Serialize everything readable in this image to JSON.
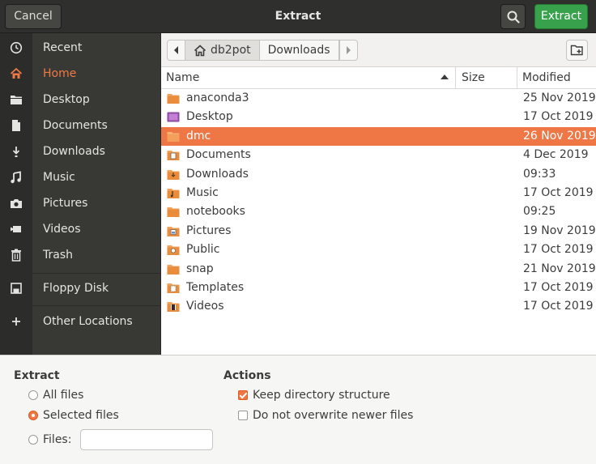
{
  "header": {
    "title": "Extract",
    "cancel_label": "Cancel",
    "extract_label": "Extract",
    "search_icon": "search-icon"
  },
  "sidebar": {
    "items": [
      {
        "label": "Recent",
        "icon": "clock-icon"
      },
      {
        "label": "Home",
        "icon": "home-icon",
        "active": true
      },
      {
        "label": "Desktop",
        "icon": "folder-icon"
      },
      {
        "label": "Documents",
        "icon": "document-icon"
      },
      {
        "label": "Downloads",
        "icon": "download-icon"
      },
      {
        "label": "Music",
        "icon": "music-icon"
      },
      {
        "label": "Pictures",
        "icon": "camera-icon"
      },
      {
        "label": "Videos",
        "icon": "video-icon"
      },
      {
        "label": "Trash",
        "icon": "trash-icon"
      },
      {
        "label": "Floppy Disk",
        "icon": "floppy-disk-icon"
      },
      {
        "label": "Other Locations",
        "icon": "plus-icon"
      }
    ]
  },
  "pathbar": {
    "segments": [
      "db2pot",
      "Downloads"
    ],
    "new_folder_icon": "new-folder-icon"
  },
  "filelist": {
    "columns": {
      "name": "Name",
      "size": "Size",
      "modified": "Modified"
    },
    "sort": "ascending",
    "rows": [
      {
        "name": "anaconda3",
        "modified": "25 Nov 2019",
        "icon": "folder"
      },
      {
        "name": "Desktop",
        "modified": "17 Oct 2019",
        "icon": "desktop-folder"
      },
      {
        "name": "dmc",
        "modified": "26 Nov 2019",
        "icon": "folder",
        "selected": true
      },
      {
        "name": "Documents",
        "modified": "4 Dec 2019",
        "icon": "documents-folder"
      },
      {
        "name": "Downloads",
        "modified": "09:33",
        "icon": "downloads-folder"
      },
      {
        "name": "Music",
        "modified": "17 Oct 2019",
        "icon": "music-folder"
      },
      {
        "name": "notebooks",
        "modified": "09:25",
        "icon": "folder"
      },
      {
        "name": "Pictures",
        "modified": "19 Nov 2019",
        "icon": "pictures-folder"
      },
      {
        "name": "Public",
        "modified": "17 Oct 2019",
        "icon": "public-folder"
      },
      {
        "name": "snap",
        "modified": "21 Nov 2019",
        "icon": "folder"
      },
      {
        "name": "Templates",
        "modified": "17 Oct 2019",
        "icon": "templates-folder"
      },
      {
        "name": "Videos",
        "modified": "17 Oct 2019",
        "icon": "videos-folder"
      }
    ]
  },
  "options": {
    "extract_heading": "Extract",
    "all_files": "All files",
    "selected_files": "Selected files",
    "files_label": "Files:",
    "files_value": "",
    "selected_radio": "selected_files",
    "actions_heading": "Actions",
    "keep_structure": "Keep directory structure",
    "keep_structure_checked": true,
    "no_overwrite": "Do not overwrite newer files",
    "no_overwrite_checked": false
  },
  "colors": {
    "accent": "#ef7645",
    "extract_button": "#38a14b",
    "headerbar": "#2f2f2d",
    "sidebar": "#383835"
  }
}
